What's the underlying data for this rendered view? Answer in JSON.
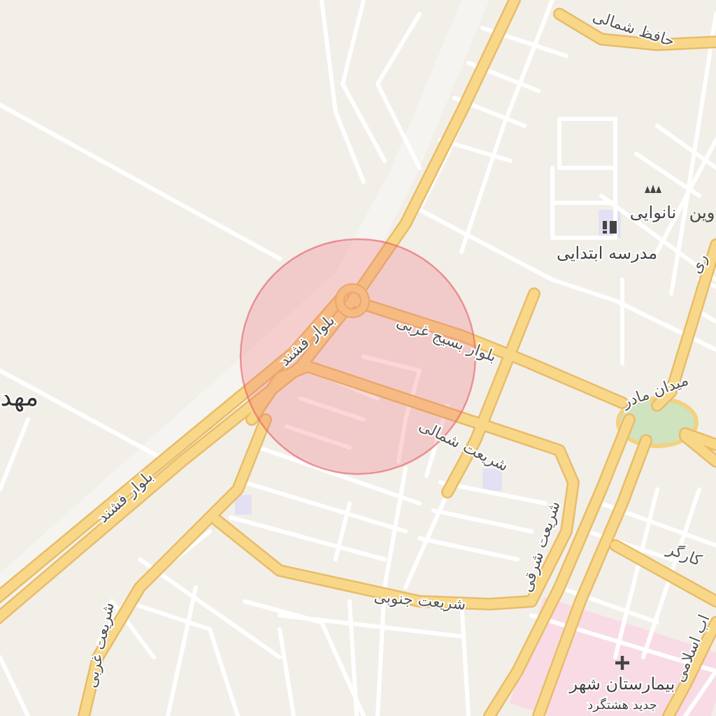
{
  "map": {
    "road_labels": [
      {
        "text": "حافظ شمالی",
        "kind": "road"
      },
      {
        "text": "بلوار فشند",
        "kind": "road"
      },
      {
        "text": "بلوار بسیج غربی",
        "kind": "road"
      },
      {
        "text": "میدان مادر",
        "kind": "road"
      },
      {
        "text": "شریعت شمالی",
        "kind": "road"
      },
      {
        "text": "بلوار فشند",
        "kind": "road"
      },
      {
        "text": "شریعت غربی",
        "kind": "road"
      },
      {
        "text": "شریعت شرقی",
        "kind": "road"
      },
      {
        "text": "شریعت جنوبی",
        "kind": "road"
      },
      {
        "text": "کارگر",
        "kind": "road"
      },
      {
        "text": "اب اسلامی",
        "kind": "road"
      },
      {
        "text": "ری",
        "kind": "road"
      }
    ],
    "place_labels": [
      {
        "text": "مهد",
        "kind": "place"
      },
      {
        "text": "وین",
        "kind": "place"
      }
    ],
    "pois": [
      {
        "label": "نانوایی",
        "kind": "bakery"
      },
      {
        "label": "مدرسه ابتدایی",
        "kind": "school"
      },
      {
        "label": "بیمارستان شهر",
        "kind": "hospital"
      },
      {
        "label": "جدید هشتگرد",
        "kind": "hospital-line"
      }
    ]
  }
}
